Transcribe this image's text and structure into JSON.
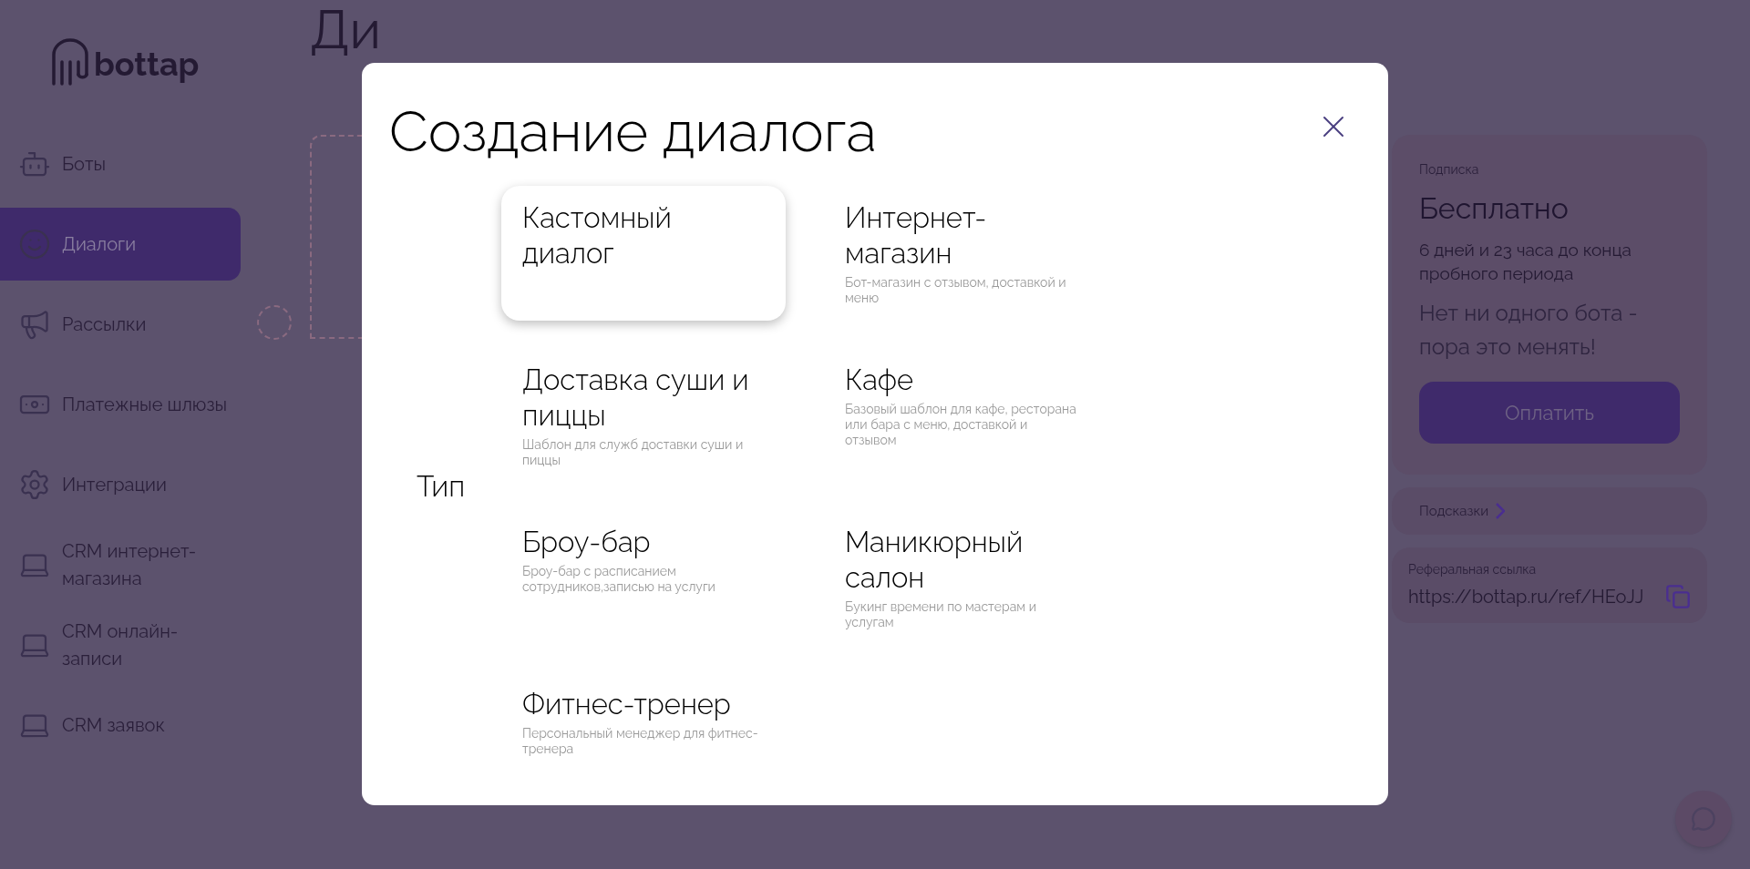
{
  "logo": {
    "text": "bottap"
  },
  "sidebar": {
    "items": [
      {
        "label": "Боты",
        "kind": "robot",
        "selected": false
      },
      {
        "label": "Диалоги",
        "kind": "face",
        "selected": true
      },
      {
        "label": "Рассылки",
        "kind": "horn",
        "selected": false
      },
      {
        "label": "Платежные шлюзы",
        "kind": "money",
        "selected": false
      },
      {
        "label": "Интеграции",
        "kind": "gear",
        "selected": false
      },
      {
        "label": "CRM интернет-магазина",
        "kind": "laptop",
        "selected": false
      },
      {
        "label": "CRM онлайн-записи",
        "kind": "laptop",
        "selected": false
      },
      {
        "label": "CRM заявок",
        "kind": "laptop",
        "selected": false
      }
    ]
  },
  "page": {
    "title": "Ди"
  },
  "subscription": {
    "caption": "Подписка",
    "plan": "Бесплатно",
    "trial": "6 дней и 23 часа до конца пробного периода",
    "message": "Нет ни одного бота - пора это менять!",
    "pay_button": "Оплатить"
  },
  "hints": {
    "label": "Подсказки"
  },
  "referral": {
    "caption": "Реферальная ссылка",
    "link": "https://bottap.ru/ref/HEoJJ"
  },
  "modal": {
    "title": "Создание диалога",
    "type_label": "Тип",
    "templates": [
      {
        "title": "Кастомный диалог",
        "selected": true
      },
      {
        "title": "Интернет-магазин",
        "description": "Бот-магазин с отзывом, доставкой и меню",
        "selected": false
      },
      {
        "title": "Доставка суши и пиццы",
        "description": "Шаблон для служб доставки суши и пиццы",
        "selected": false
      },
      {
        "title": "Кафе",
        "description": "Базовый шаблон для кафе, ресторана или бара с меню, доставкой и отзывом",
        "selected": false
      },
      {
        "title": "Броу-бар",
        "description": "Броу-бар с расписанием сотрудников,записью на услуги",
        "selected": false
      },
      {
        "title": "Маникюрный салон",
        "description": "Букинг времени по мастерам и услугам",
        "selected": false
      },
      {
        "title": "Фитнес-тренер",
        "description": "Персональный менеджер для фитнес-тренера",
        "selected": false
      }
    ]
  }
}
